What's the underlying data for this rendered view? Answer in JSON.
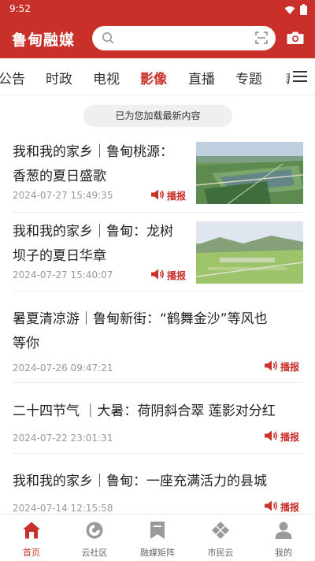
{
  "status_bar": {
    "time": "9:52"
  },
  "app_bar": {
    "title": "鲁甸融媒",
    "search_placeholder": ""
  },
  "tabs": [
    {
      "label": "公告"
    },
    {
      "label": "时政"
    },
    {
      "label": "电视"
    },
    {
      "label": "影像",
      "active": true
    },
    {
      "label": "直播"
    },
    {
      "label": "专题"
    },
    {
      "label": "新"
    }
  ],
  "toast": "已为您加载最新内容",
  "broadcast_label": "播报",
  "feed": [
    {
      "title_line1": "我和我的家乡｜鲁甸桃源：",
      "title_line2": "香葱的夏日盛歌",
      "time": "2024-07-27 15:49:35"
    },
    {
      "title_line1": "我和我的家乡｜鲁甸：龙树",
      "title_line2": "坝子的夏日华章",
      "time": "2024-07-27 15:40:07"
    },
    {
      "title_line1": "暑夏清凉游｜鲁甸新街：“鹤舞金沙”等风也",
      "title_line2": "等你",
      "time": "2024-07-26 09:47:21"
    },
    {
      "title_line1": "二十四节气 ｜大暑：荷阴斜合翠 莲影对分红",
      "time": "2024-07-22 23:01:31"
    },
    {
      "title_line1": "我和我的家乡｜鲁甸：一座充满活力的县城",
      "time": "2024-07-14 12:15:58"
    }
  ],
  "bottom_nav": [
    {
      "label": "首页",
      "icon": "home-icon",
      "active": true
    },
    {
      "label": "云社区",
      "icon": "community-icon"
    },
    {
      "label": "融媒矩阵",
      "icon": "bookmark-icon"
    },
    {
      "label": "市民云",
      "icon": "diamond-grid-icon"
    },
    {
      "label": "我的",
      "icon": "person-icon"
    }
  ],
  "colors": {
    "brand": "#c9302a",
    "muted_text": "#999999",
    "title_text": "#222222"
  }
}
